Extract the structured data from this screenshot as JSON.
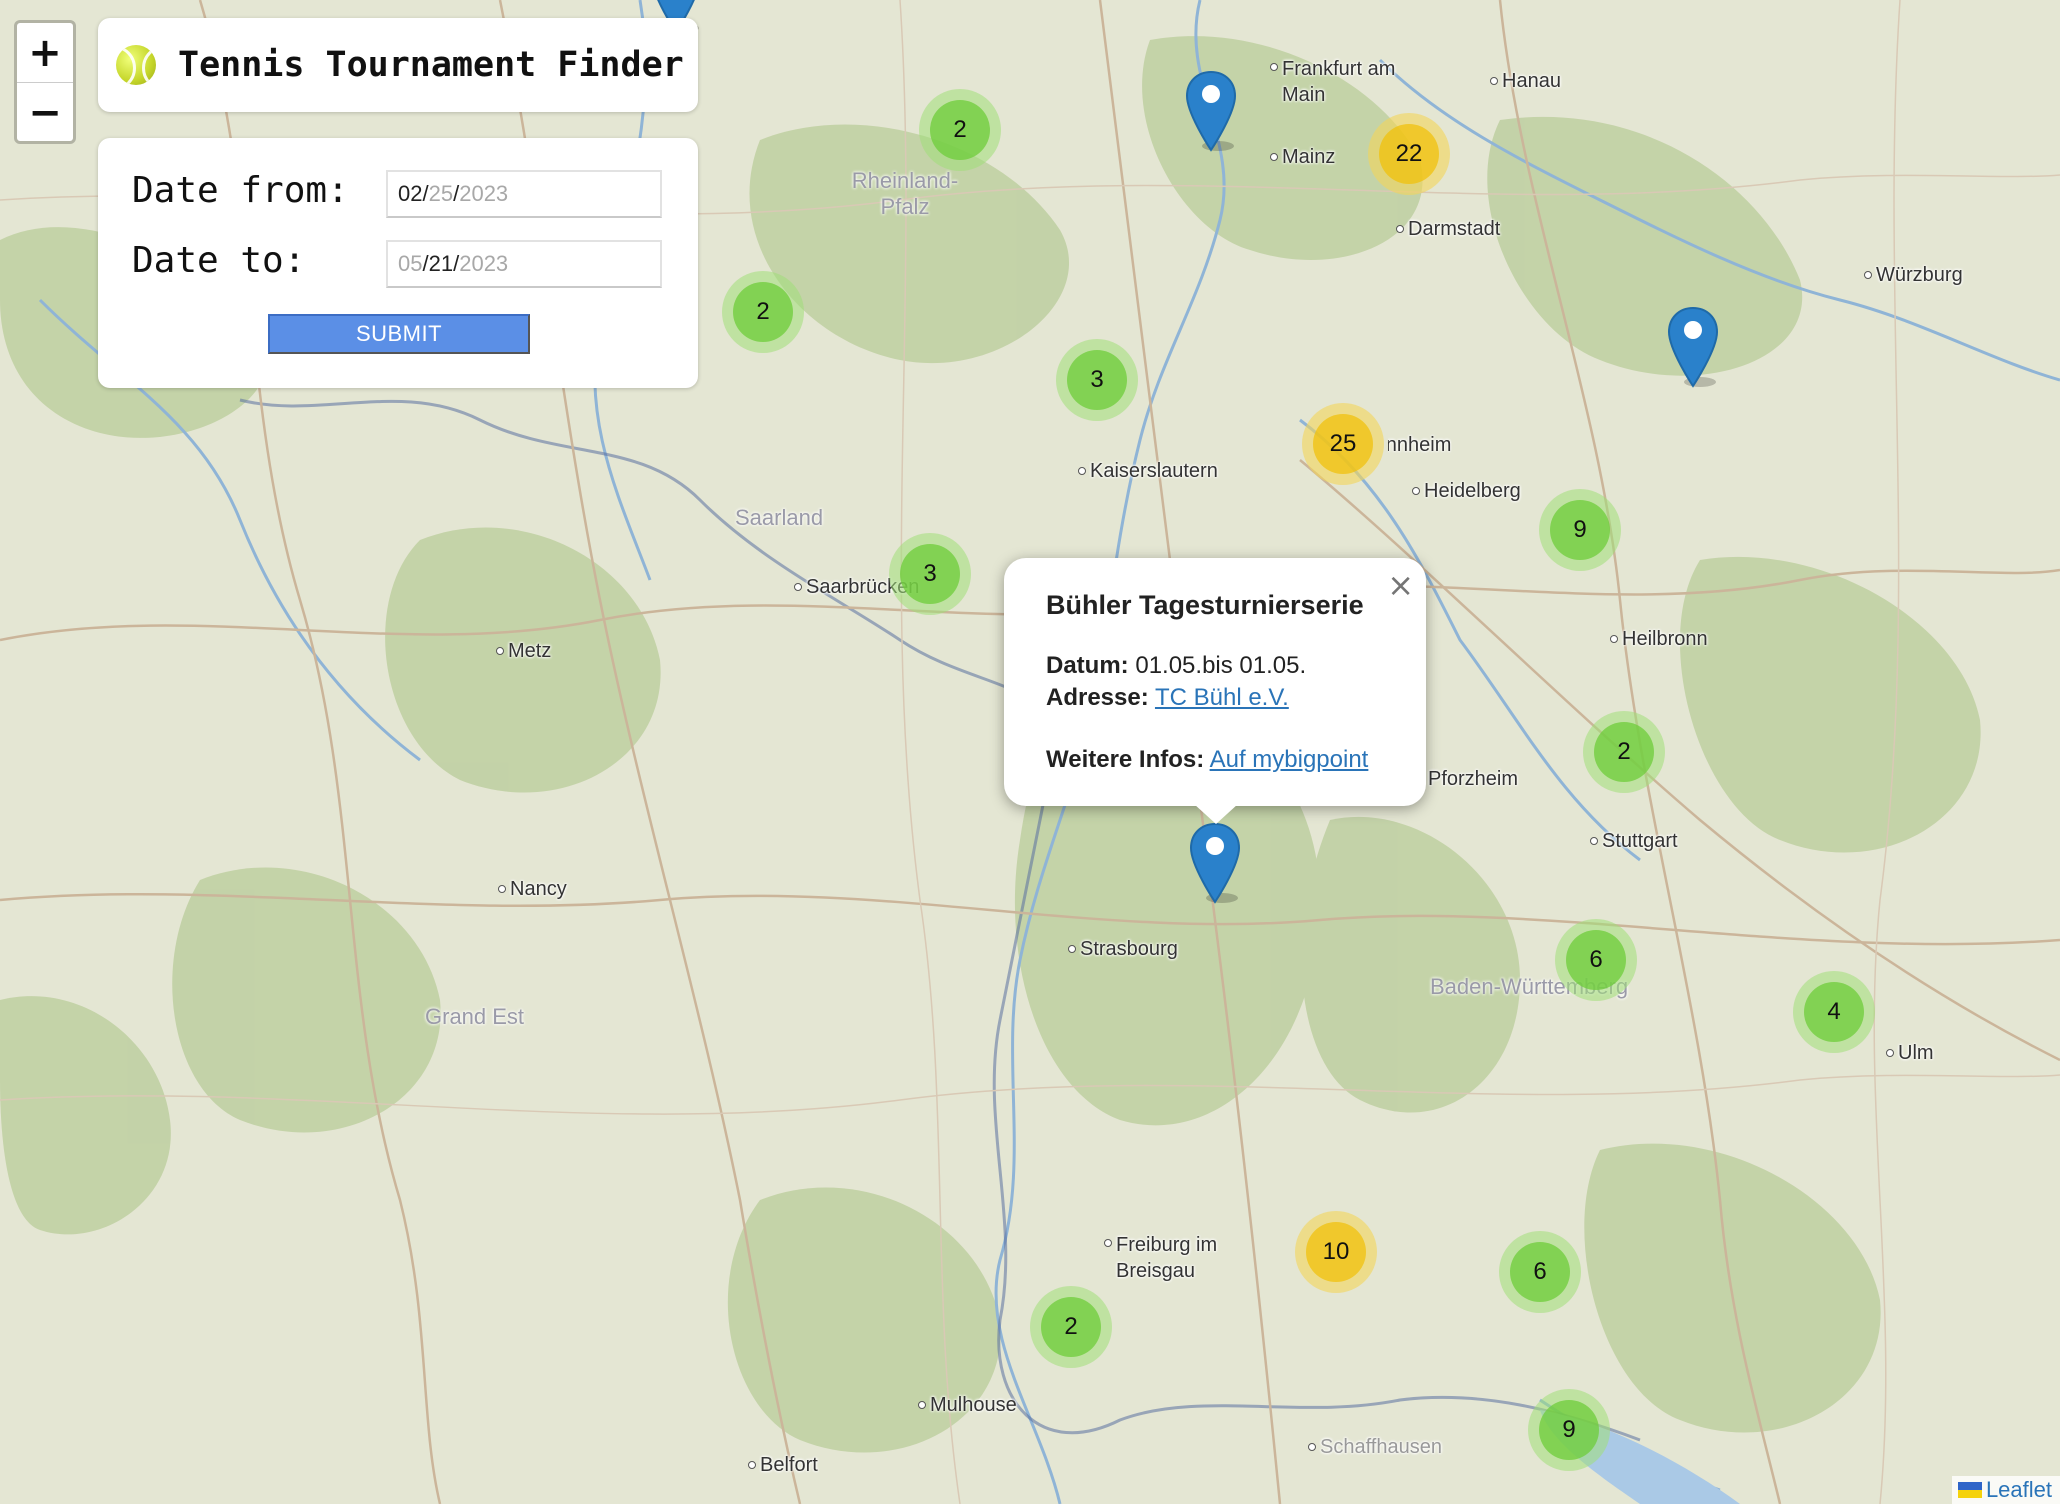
{
  "app": {
    "title": "Tennis Tournament Finder",
    "logo_icon": "tennis-ball-icon"
  },
  "zoom": {
    "in_label": "+",
    "out_label": "−"
  },
  "filter": {
    "from_label": "Date from:",
    "from_value": {
      "month": "02",
      "day": "25",
      "year": "2023"
    },
    "to_label": "Date to:",
    "to_value": {
      "month": "05",
      "day": "21",
      "year": "2023"
    },
    "submit_label": "SUBMIT"
  },
  "map": {
    "cities": [
      "Frankfurt am Main",
      "Hanau",
      "Mainz",
      "Darmstadt",
      "Würzburg",
      "Kaiserslautern",
      "Heidelberg",
      "Saarbrücken",
      "Metz",
      "Heilbronn",
      "Pforzheim",
      "Stuttgart",
      "Nancy",
      "Strasbourg",
      "Ulm",
      "Freiburg im Breisgau",
      "Mulhouse",
      "Belfort",
      "Schaffhausen",
      "Mannheim"
    ],
    "regions": [
      "Rheinland-Pfalz",
      "Saarland",
      "Grand Est",
      "Baden-Württemberg"
    ],
    "clusters": [
      {
        "count": "2",
        "size": "small"
      },
      {
        "count": "22",
        "size": "medium"
      },
      {
        "count": "2",
        "size": "small"
      },
      {
        "count": "3",
        "size": "small"
      },
      {
        "count": "25",
        "size": "medium"
      },
      {
        "count": "9",
        "size": "small"
      },
      {
        "count": "3",
        "size": "small"
      },
      {
        "count": "2",
        "size": "small"
      },
      {
        "count": "6",
        "size": "small"
      },
      {
        "count": "4",
        "size": "small"
      },
      {
        "count": "10",
        "size": "medium"
      },
      {
        "count": "6",
        "size": "small"
      },
      {
        "count": "2",
        "size": "small"
      },
      {
        "count": "9",
        "size": "small"
      }
    ],
    "marker_color": "#2a81cb"
  },
  "popup": {
    "title": "Bühler Tagesturnierserie",
    "date_label": "Datum:",
    "date_value": "01.05.bis 01.05.",
    "address_label": "Adresse:",
    "address_link": "TC Bühl e.V.",
    "info_label": "Weitere Infos:",
    "info_link": "Auf mybigpoint",
    "close_label": "×"
  },
  "attribution": {
    "text": "Leaflet"
  }
}
